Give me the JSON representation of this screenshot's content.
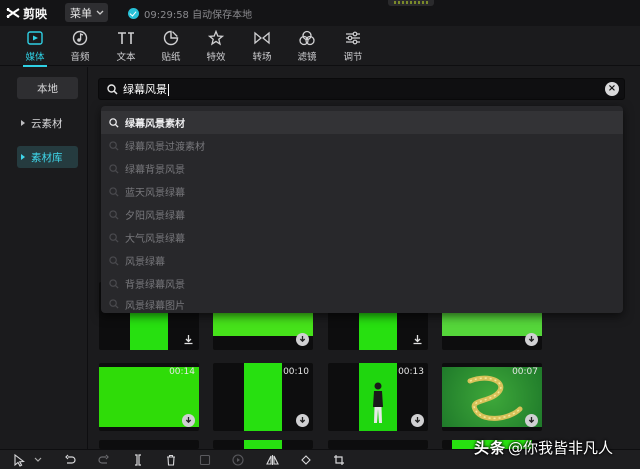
{
  "app": {
    "name": "剪映",
    "menu_label": "菜单",
    "status_text": "09:29:58 自动保存本地",
    "accent_color": "#2fd0e4"
  },
  "tool_tabs": [
    {
      "label": "媒体",
      "icon": "media-icon",
      "active": true
    },
    {
      "label": "音频",
      "icon": "audio-icon",
      "active": false
    },
    {
      "label": "文本",
      "icon": "text-icon",
      "active": false
    },
    {
      "label": "贴纸",
      "icon": "sticker-icon",
      "active": false
    },
    {
      "label": "特效",
      "icon": "effects-icon",
      "active": false
    },
    {
      "label": "转场",
      "icon": "transition-icon",
      "active": false
    },
    {
      "label": "滤镜",
      "icon": "filter-icon",
      "active": false
    },
    {
      "label": "调节",
      "icon": "adjust-icon",
      "active": false
    }
  ],
  "sidebar": {
    "items": [
      {
        "label": "本地"
      },
      {
        "label": "云素材"
      },
      {
        "label": "素材库",
        "active": true
      }
    ]
  },
  "search": {
    "value": "绿幕风景"
  },
  "suggestions": [
    "绿幕风景素材",
    "绿幕风景过渡素材",
    "绿幕背景风景",
    "蓝天风景绿幕",
    "夕阳风景绿幕",
    "大气风景绿幕",
    "风景绿幕",
    "背景绿幕风景",
    "风景绿幕图片"
  ],
  "media_grid": {
    "items": [
      {
        "duration": "",
        "style": "narrow-green"
      },
      {
        "duration": "",
        "style": "wide-green"
      },
      {
        "duration": "",
        "style": "narrow-green"
      },
      {
        "duration": "",
        "style": "wide-green-light"
      },
      {
        "duration": "00:14",
        "style": "full-green"
      },
      {
        "duration": "00:10",
        "style": "narrow-green"
      },
      {
        "duration": "00:13",
        "style": "person-green"
      },
      {
        "duration": "00:07",
        "style": "dragon-green"
      }
    ]
  },
  "bottom_toolbar": {
    "icons": [
      "select-icon",
      "undo-icon",
      "redo-icon",
      "split-icon",
      "delete-icon",
      "freeze-icon",
      "play-icon",
      "mirror-icon",
      "rotate-icon",
      "crop-icon"
    ]
  },
  "watermark": {
    "brand": "头条",
    "handle": "@你我皆非凡人"
  }
}
